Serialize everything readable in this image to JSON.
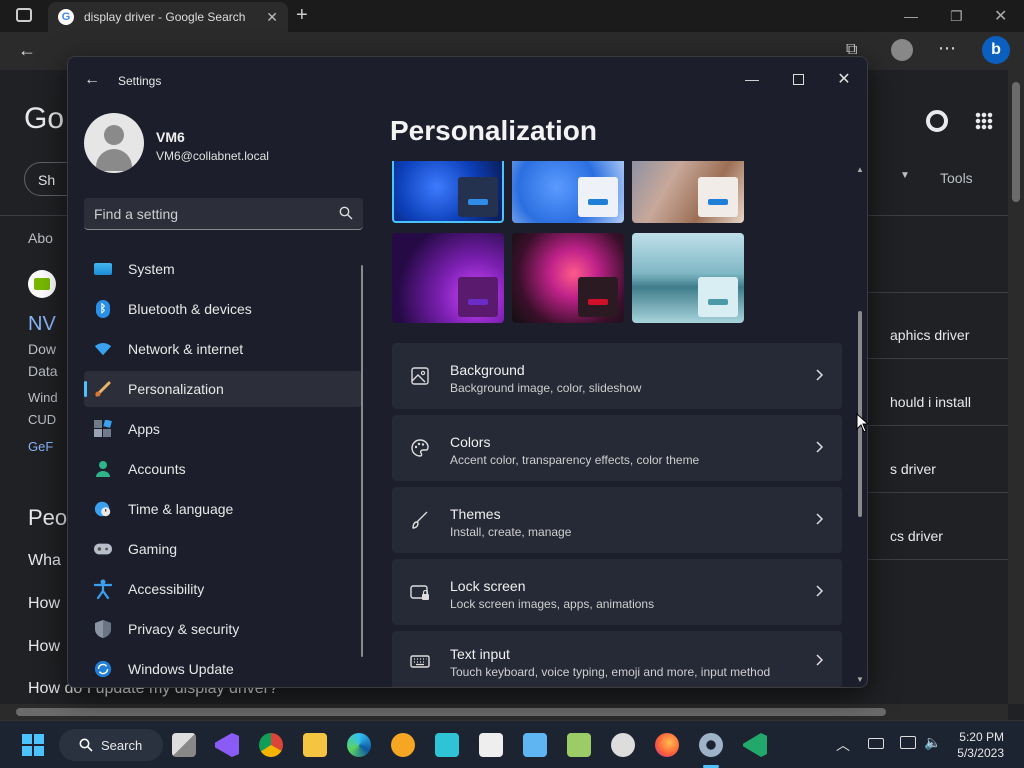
{
  "browser": {
    "tab_title": "display driver - Google Search",
    "tools_label": "Tools"
  },
  "google": {
    "logo_partial": "Go",
    "chip_partial": "Sh",
    "about_partial": "Abo",
    "result_title_partial": "NV",
    "result_line1": "Dow",
    "result_line2": "Data",
    "result_line3": "Wind",
    "result_line4": "CUD",
    "result_link": "GeF",
    "people_partial": "Peo",
    "faq1": "Wha",
    "faq2": "How",
    "faq3": "How",
    "faq4": "How do I update my display driver?",
    "related1": "aphics driver",
    "related2": "hould i install",
    "related3": "s driver",
    "related4": "cs driver"
  },
  "settings": {
    "title": "Settings",
    "user_name": "VM6",
    "user_email": "VM6@collabnet.local",
    "search_placeholder": "Find a setting",
    "page_title": "Personalization",
    "nav": [
      {
        "label": "System",
        "icon": "system-icon"
      },
      {
        "label": "Bluetooth & devices",
        "icon": "bluetooth-icon"
      },
      {
        "label": "Network & internet",
        "icon": "wifi-icon"
      },
      {
        "label": "Personalization",
        "icon": "brush-icon"
      },
      {
        "label": "Apps",
        "icon": "apps-icon"
      },
      {
        "label": "Accounts",
        "icon": "accounts-icon"
      },
      {
        "label": "Time & language",
        "icon": "clock-icon"
      },
      {
        "label": "Gaming",
        "icon": "gamepad-icon"
      },
      {
        "label": "Accessibility",
        "icon": "accessibility-icon"
      },
      {
        "label": "Privacy & security",
        "icon": "shield-icon"
      },
      {
        "label": "Windows Update",
        "icon": "update-icon"
      }
    ],
    "cards": [
      {
        "title": "Background",
        "subtitle": "Background image, color, slideshow",
        "icon": "image-icon"
      },
      {
        "title": "Colors",
        "subtitle": "Accent color, transparency effects, color theme",
        "icon": "palette-icon"
      },
      {
        "title": "Themes",
        "subtitle": "Install, create, manage",
        "icon": "brush-icon"
      },
      {
        "title": "Lock screen",
        "subtitle": "Lock screen images, apps, animations",
        "icon": "lock-screen-icon"
      },
      {
        "title": "Text input",
        "subtitle": "Touch keyboard, voice typing, emoji and more, input method",
        "icon": "keyboard-icon"
      }
    ]
  },
  "taskbar": {
    "search_label": "Search",
    "time": "5:20 PM",
    "date": "5/3/2023"
  },
  "colors": {
    "accent": "#4cc2ff",
    "window_bg": "#1c1f2b",
    "card_bg": "#262a36"
  }
}
